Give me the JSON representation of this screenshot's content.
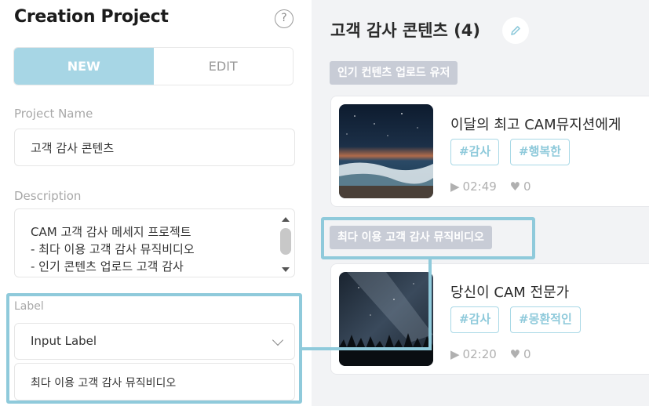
{
  "panel": {
    "title": "Creation Project",
    "help_icon": "?",
    "tabs": {
      "new": "NEW",
      "edit": "EDIT"
    },
    "project_name": {
      "label": "Project Name",
      "value": "고객 감사 콘텐츠"
    },
    "description": {
      "label": "Description",
      "value": "CAM 고객 감사 메세지 프로젝트\n- 최다 이용 고객 감사 뮤직비디오\n- 인기 콘텐츠 업로드 고객 감사\n- 최근 출대 다서 고객 가사"
    },
    "label_section": {
      "label": "Label",
      "select_value": "Input Label",
      "input_value": "최다 이용 고객 감사 뮤직비디오"
    }
  },
  "content": {
    "title": "고객 감사 콘텐츠 (4)",
    "groups": [
      {
        "tag": "인기 컨텐츠 업로드 유저",
        "card": {
          "title": "이달의 최고 CAM뮤지션에게",
          "hashtags": [
            "#감사",
            "#행복한"
          ],
          "duration": "02:49",
          "likes": "0"
        }
      },
      {
        "tag": "최다 이용 고객 감사 뮤직비디오",
        "card": {
          "title": "당신이 CAM 전문가",
          "hashtags": [
            "#감사",
            "#몽환적인"
          ],
          "duration": "02:20",
          "likes": "0"
        }
      }
    ]
  },
  "colors": {
    "accent": "#a7d6e5",
    "highlight": "#8fcadb",
    "tag_bg": "#c8ccd6",
    "right_bg": "#f2f3f5"
  }
}
